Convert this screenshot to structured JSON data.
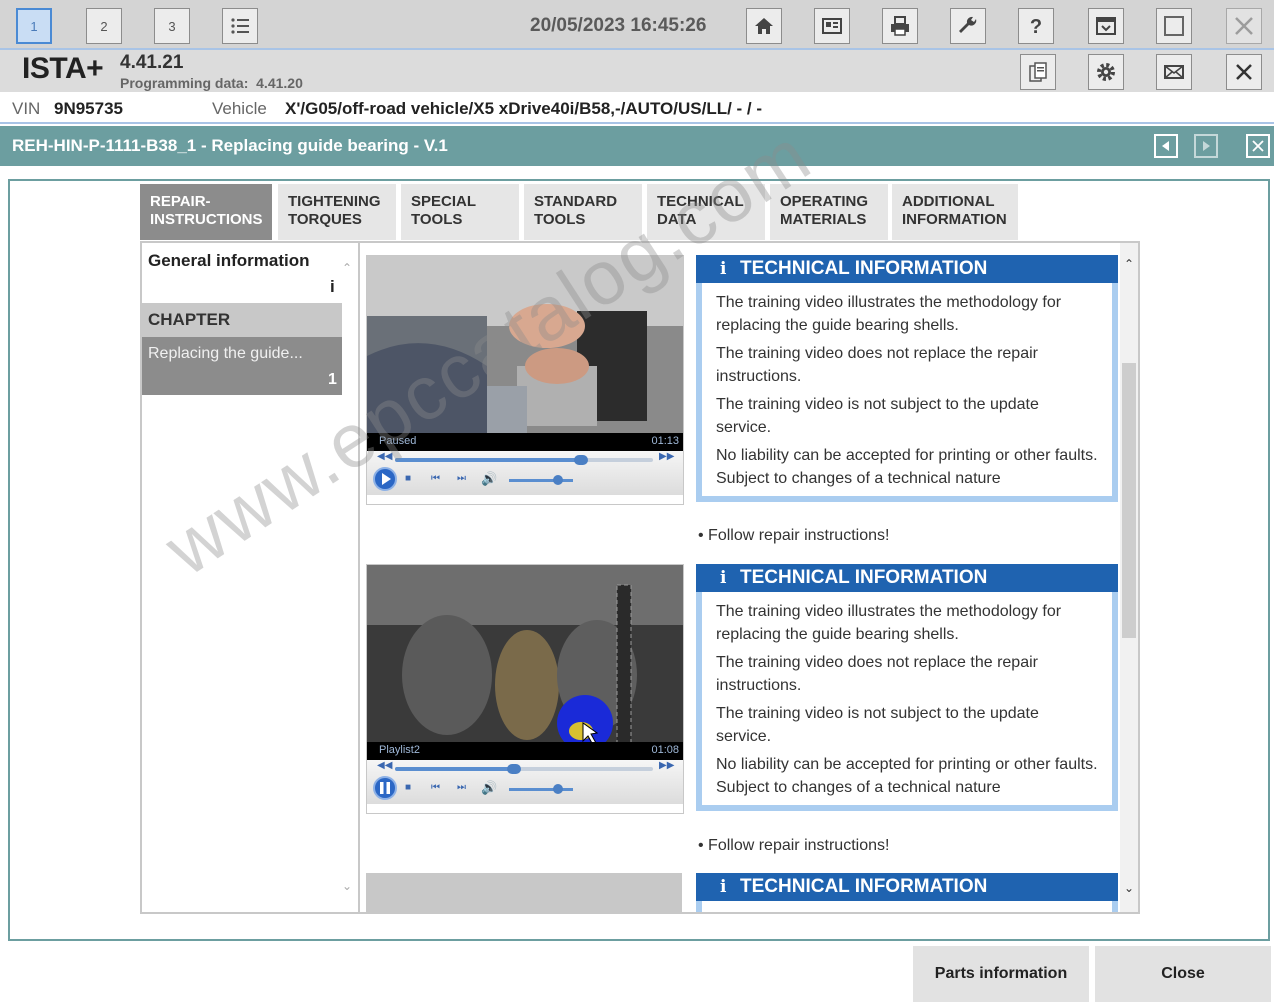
{
  "toolbar": {
    "window_buttons": [
      "1",
      "2",
      "3"
    ],
    "datetime": "20/05/2023 16:45:26",
    "icons": [
      "list-icon",
      "home-icon",
      "id-card-icon",
      "printer-icon",
      "wrench-icon",
      "help-icon",
      "display-settings-icon",
      "window-icon",
      "close-icon"
    ]
  },
  "header": {
    "app_name": "ISTA+",
    "version": "4.41.21",
    "programming_label": "Programming data:",
    "programming_value": "4.41.20",
    "icons": [
      "documents-icon",
      "settings-gear-icon",
      "mail-icon",
      "close-icon"
    ]
  },
  "vehicle_row": {
    "vin_label": "VIN",
    "vin_value": "9N95735",
    "vehicle_label": "Vehicle",
    "vehicle_value": "X'/G05/off-road vehicle/X5 xDrive40i/B58,-/AUTO/US/LL/ - / -"
  },
  "title_bar": {
    "title": "REH-HIN-P-1111-B38_1 - Replacing guide bearing - V.1"
  },
  "tabs": [
    {
      "line1": "REPAIR-",
      "line2": "INSTRUCTIONS",
      "active": true
    },
    {
      "line1": "TIGHTENING",
      "line2": "TORQUES"
    },
    {
      "line1": "SPECIAL",
      "line2": "TOOLS"
    },
    {
      "line1": "STANDARD",
      "line2": "TOOLS"
    },
    {
      "line1": "TECHNICAL",
      "line2": "DATA"
    },
    {
      "line1": "OPERATING",
      "line2": "MATERIALS"
    },
    {
      "line1": "ADDITIONAL",
      "line2": "INFORMATION"
    }
  ],
  "nav": {
    "general_info": "General information",
    "general_info_badge": "i",
    "chapter": "CHAPTER",
    "selected_item": "Replacing the guide...",
    "selected_item_num": "1"
  },
  "videos": [
    {
      "status": "Paused",
      "time": "01:13",
      "progress": 0.72
    },
    {
      "status": "Playlist2",
      "time": "01:08",
      "progress": 0.46
    }
  ],
  "tech_info": {
    "header": "TECHNICAL INFORMATION",
    "icon": "i",
    "p1": "The training video illustrates the methodology for replacing the guide bearing shells.",
    "p2": "The training video does not replace the repair instructions.",
    "p3": "The training video is not subject to the update service.",
    "p4": "No liability can be accepted for printing or other faults. Subject to changes of a technical nature"
  },
  "follow_text": "Follow repair instructions!",
  "watermark": "www.epccatalog.com",
  "bottom_buttons": {
    "parts": "Parts information",
    "close": "Close"
  }
}
